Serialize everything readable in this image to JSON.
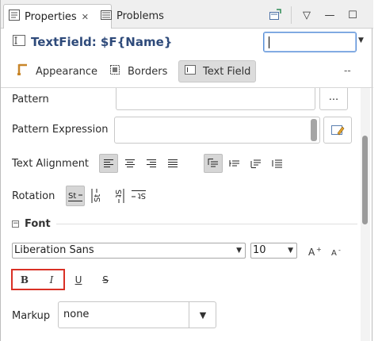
{
  "tabs": {
    "properties": "Properties",
    "properties_close": "✕",
    "problems": "Problems"
  },
  "toolbar": {
    "menu_glyph": "▽",
    "minimize_glyph": "—",
    "maximize_glyph": "☐"
  },
  "header": {
    "title": "TextField: $F{Name}",
    "combo_value": ""
  },
  "sections": {
    "appearance": "Appearance",
    "borders": "Borders",
    "text_field": "Text Field",
    "overflow": "--"
  },
  "props": {
    "pattern_label": "Pattern",
    "pattern_button": "...",
    "pattern_expression_label": "Pattern Expression",
    "text_alignment_label": "Text Alignment",
    "rotation_label": "Rotation",
    "font_section": "Font",
    "font_name": "Liberation Sans",
    "font_size": "10",
    "markup_label": "Markup",
    "markup_value": "none"
  },
  "style_buttons": {
    "bold": "B",
    "italic": "I",
    "underline": "U",
    "strike": "S"
  },
  "colors": {
    "accent": "#2e4a7a",
    "highlight_border": "#d93025",
    "focus_border": "#5a8fd6"
  }
}
